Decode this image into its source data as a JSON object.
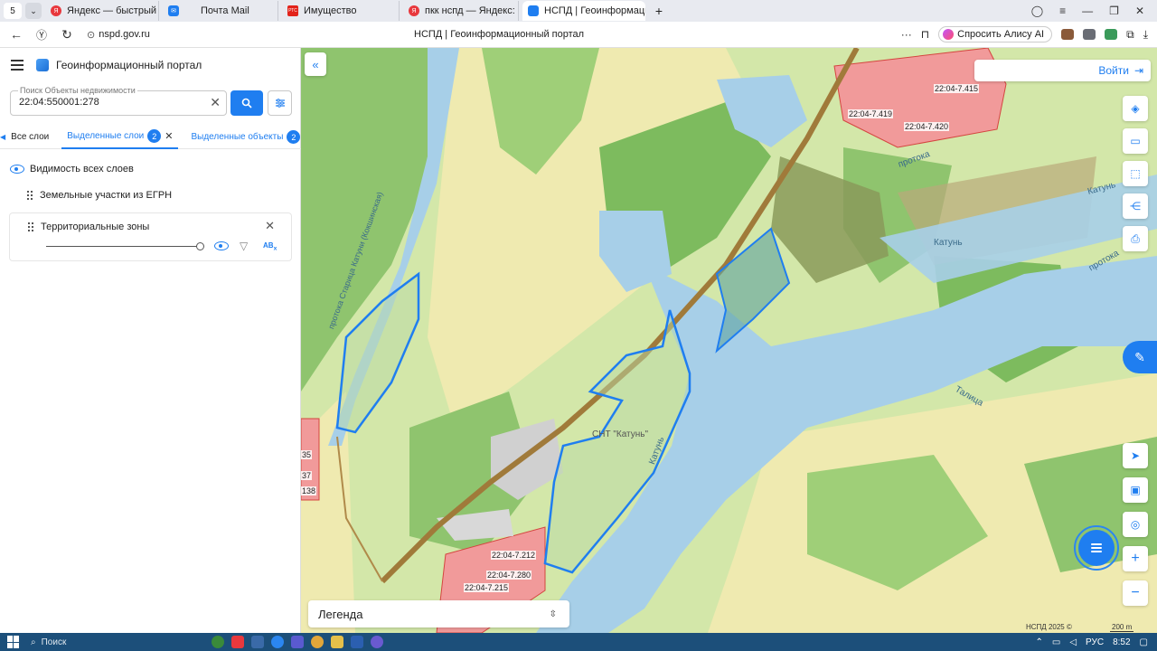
{
  "browser": {
    "tab_counter": "5",
    "tabs": [
      {
        "label": "Яндекс — быстрый поиск",
        "favicon_color": "#e8383d"
      },
      {
        "label": "Почта Mail",
        "favicon_color": "#1f7ef0"
      },
      {
        "label": "Имущество",
        "favicon_color": "#e2231a"
      },
      {
        "label": "пкк нспд — Яндекс: нашё",
        "favicon_color": "#e8383d"
      },
      {
        "label": "НСПД | Геоинформаци",
        "favicon_color": "#1f7ef0"
      }
    ],
    "url": "nspd.gov.ru",
    "page_title": "НСПД | Геоинформационный портал",
    "alice_label": "Спросить Алису AI"
  },
  "panel": {
    "portal_name": "Геоинформационный портал",
    "search": {
      "label": "Поиск Объекты недвижимости",
      "value": "22:04:550001:278"
    },
    "tabs": [
      {
        "label": "Все слои"
      },
      {
        "label": "Выделенные слои",
        "count": "2"
      },
      {
        "label": "Выделенные объекты",
        "count": "2"
      }
    ],
    "visibility_label": "Видимость всех слоев",
    "layers": [
      {
        "label": "Земельные участки из ЕГРН"
      },
      {
        "label": "Территориальные зоны"
      }
    ]
  },
  "map": {
    "login_label": "Войти",
    "legend_label": "Легенда",
    "copyright": "НСПД 2025 ©",
    "scale": "200 m",
    "labels": [
      {
        "text": "22:04-7.415"
      },
      {
        "text": "22:04-7.419"
      },
      {
        "text": "22:04-7.420"
      },
      {
        "text": "22:04-7.212"
      },
      {
        "text": "22:04-7.280"
      },
      {
        "text": "22:04-7.215"
      },
      {
        "text": "35"
      },
      {
        "text": "37"
      },
      {
        "text": "138"
      }
    ],
    "river_labels": [
      {
        "text": "Катунь"
      },
      {
        "text": "Катунь"
      },
      {
        "text": "Катунь"
      },
      {
        "text": "Талица"
      },
      {
        "text": "протока"
      },
      {
        "text": "протока"
      },
      {
        "text": "протока Старица Катуни (Кокшинская)"
      },
      {
        "text": "СНТ \"Катунь\""
      }
    ],
    "colors": {
      "land": "#d3e7a9",
      "yellow": "#efeab0",
      "forest": "#8fc46e",
      "water": "#a7cfe8",
      "selection": "#1f7ef0",
      "settlement": "#f19a9a",
      "road": "#a07a3a"
    }
  },
  "taskbar": {
    "search_label": "Поиск",
    "lang": "РУС",
    "time": "8:52"
  }
}
